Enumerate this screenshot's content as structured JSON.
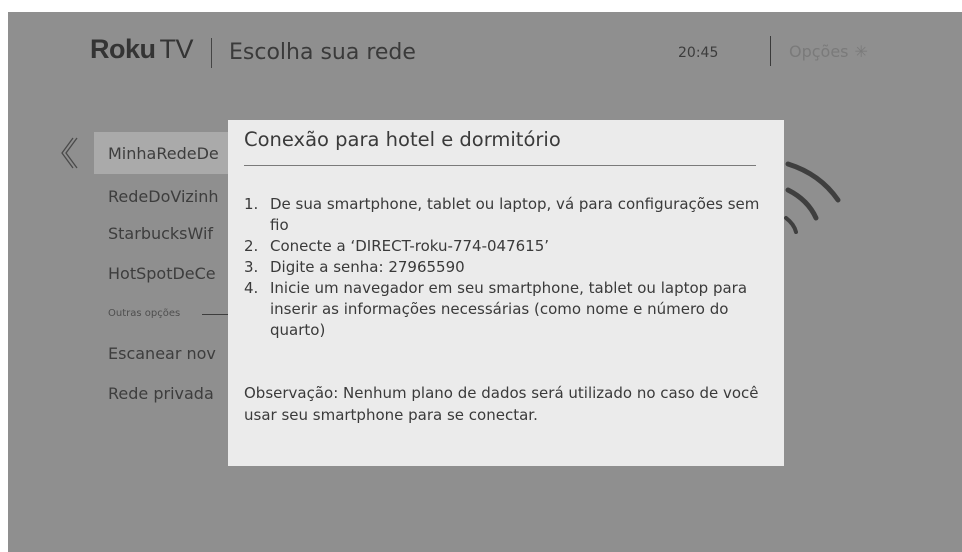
{
  "header": {
    "logo_brand": "Roku",
    "logo_suffix": "TV",
    "title": "Escolha sua rede",
    "time": "20:45",
    "options_label": "Opções",
    "options_icon": "asterisk-icon"
  },
  "network_list": {
    "back_icon": "chevron-left-icon",
    "items": [
      {
        "label": "MinhaRedeDe"
      },
      {
        "label": "RedeDoVizinh"
      },
      {
        "label": "StarbucksWif"
      },
      {
        "label": "HotSpotDeCe"
      }
    ],
    "section_label": "Outras opções",
    "other_options": [
      {
        "label": "Escanear nov"
      },
      {
        "label": "Rede privada"
      }
    ]
  },
  "modal": {
    "title": "Conexão para hotel e dormitório",
    "steps": [
      {
        "number": "1.",
        "text": "De sua smartphone, tablet ou laptop, vá para configurações sem fio"
      },
      {
        "number": "2.",
        "text": "Conecte a ‘DIRECT-roku-774-047615’"
      },
      {
        "number": "3.",
        "text": "Digite a senha: 27965590"
      },
      {
        "number": "4.",
        "text": "Inicie um navegador em seu smartphone, tablet ou laptop para inserir as informações necessárias (como nome e número do quarto)"
      }
    ],
    "note": "Observação: Nenhum plano de dados será utilizado no caso de você usar seu smartphone para se conectar."
  },
  "colors": {
    "background_dim": "#8f8f8f",
    "modal_bg": "#ebebeb",
    "text": "#3a3a3a"
  }
}
